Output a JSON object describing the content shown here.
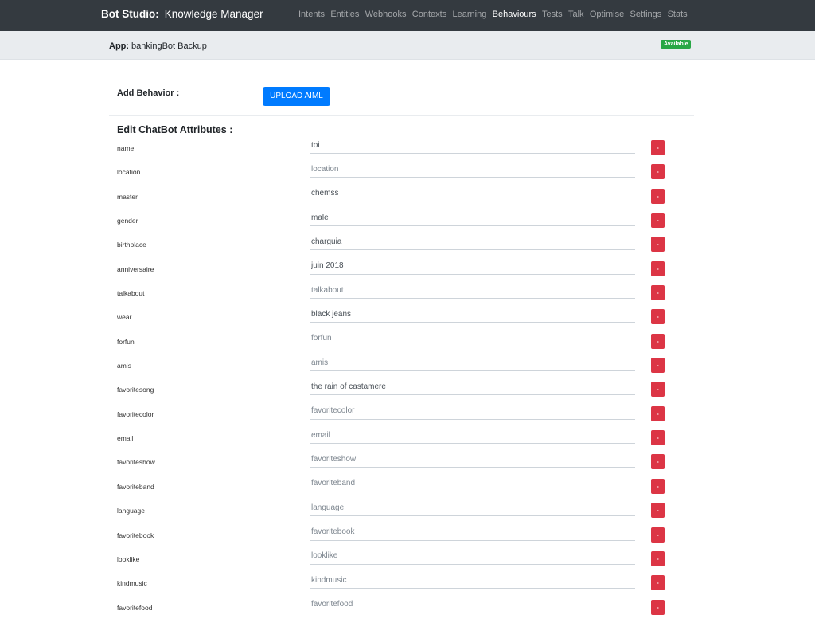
{
  "navbar": {
    "brand_bold": "Bot Studio:",
    "brand_sub": "Knowledge Manager",
    "links": [
      {
        "label": "Intents",
        "active": false
      },
      {
        "label": "Entities",
        "active": false
      },
      {
        "label": "Webhooks",
        "active": false
      },
      {
        "label": "Contexts",
        "active": false
      },
      {
        "label": "Learning",
        "active": false
      },
      {
        "label": "Behaviours",
        "active": true
      },
      {
        "label": "Tests",
        "active": false
      },
      {
        "label": "Talk",
        "active": false
      },
      {
        "label": "Optimise",
        "active": false
      },
      {
        "label": "Settings",
        "active": false
      },
      {
        "label": "Stats",
        "active": false
      }
    ]
  },
  "subbar": {
    "app_label": "App:",
    "app_name": "bankingBot Backup",
    "status_badge": "Available"
  },
  "content": {
    "add_behavior_label": "Add Behavior :",
    "upload_button": "UPLOAD AIML",
    "section_title": "Edit ChatBot Attributes :",
    "delete_label": "-",
    "attributes": [
      {
        "name": "name",
        "value": "toi",
        "placeholder": "name"
      },
      {
        "name": "location",
        "value": "",
        "placeholder": "location"
      },
      {
        "name": "master",
        "value": "chemss",
        "placeholder": "master"
      },
      {
        "name": "gender",
        "value": "male",
        "placeholder": "gender"
      },
      {
        "name": "birthplace",
        "value": "charguia",
        "placeholder": "birthplace"
      },
      {
        "name": "anniversaire",
        "value": "juin 2018",
        "placeholder": "anniversaire"
      },
      {
        "name": "talkabout",
        "value": "",
        "placeholder": "talkabout"
      },
      {
        "name": "wear",
        "value": "black jeans",
        "placeholder": "wear"
      },
      {
        "name": "forfun",
        "value": "",
        "placeholder": "forfun"
      },
      {
        "name": "amis",
        "value": "",
        "placeholder": "amis"
      },
      {
        "name": "favoritesong",
        "value": "the rain of castamere",
        "placeholder": "favoritesong"
      },
      {
        "name": "favoritecolor",
        "value": "",
        "placeholder": "favoritecolor"
      },
      {
        "name": "email",
        "value": "",
        "placeholder": "email"
      },
      {
        "name": "favoriteshow",
        "value": "",
        "placeholder": "favoriteshow"
      },
      {
        "name": "favoriteband",
        "value": "",
        "placeholder": "favoriteband"
      },
      {
        "name": "language",
        "value": "",
        "placeholder": "language"
      },
      {
        "name": "favoritebook",
        "value": "",
        "placeholder": "favoritebook"
      },
      {
        "name": "looklike",
        "value": "",
        "placeholder": "looklike"
      },
      {
        "name": "kindmusic",
        "value": "",
        "placeholder": "kindmusic"
      },
      {
        "name": "favoritefood",
        "value": "",
        "placeholder": "favoritefood"
      }
    ]
  }
}
